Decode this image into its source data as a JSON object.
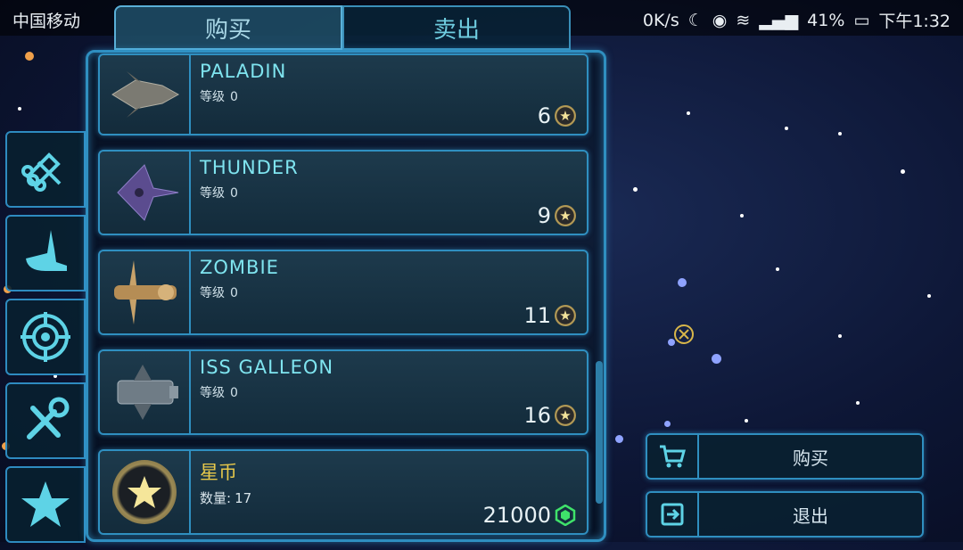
{
  "status_bar": {
    "carrier": "中国移动",
    "speed": "0K/s",
    "battery": "41%",
    "time": "下午1:32"
  },
  "tabs": [
    {
      "label": "购买",
      "active": true
    },
    {
      "label": "卖出",
      "active": false
    }
  ],
  "side_tabs": [
    {
      "icon": "ammo-icon"
    },
    {
      "icon": "wing-icon"
    },
    {
      "icon": "target-icon"
    },
    {
      "icon": "tools-icon"
    },
    {
      "icon": "star-icon"
    }
  ],
  "level_label": "等级",
  "items": [
    {
      "name": "PALADIN",
      "level": "0",
      "price": "6",
      "currency_icon": "star-coin-icon"
    },
    {
      "name": "THUNDER",
      "level": "0",
      "price": "9",
      "currency_icon": "star-coin-icon"
    },
    {
      "name": "ZOMBIE",
      "level": "0",
      "price": "11",
      "currency_icon": "star-coin-icon"
    },
    {
      "name": "ISS GALLEON",
      "level": "0",
      "price": "16",
      "currency_icon": "star-coin-icon"
    }
  ],
  "currency_item": {
    "name": "星币",
    "qty_label": "数量:",
    "qty": "17",
    "price": "21000",
    "currency_icon": "green-gem-icon"
  },
  "actions": {
    "buy_label": "购买",
    "exit_label": "退出"
  },
  "colors": {
    "accent": "#2f8fc0",
    "name_text": "#7fe4ef",
    "gold_text": "#e7c84a",
    "gem_green": "#3fe26a"
  }
}
